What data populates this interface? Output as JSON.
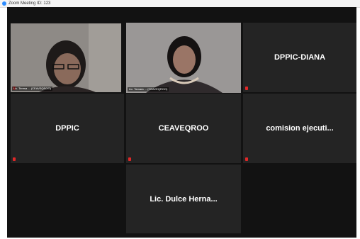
{
  "window": {
    "title": "Zoom Meeting ID: 123"
  },
  "participants": [
    {
      "id": "p1",
      "type": "video",
      "label": "Lic. Teresa ... (CEAVEQROO)",
      "muted": true
    },
    {
      "id": "p2",
      "type": "video",
      "label": "Lic. Tamara ... (CEAVEQROO)",
      "muted": true,
      "active_speaker": true
    },
    {
      "id": "p3",
      "type": "name",
      "name": "DPPIC-DIANA",
      "muted": true
    },
    {
      "id": "p4",
      "type": "name",
      "name": "DPPIC",
      "muted": true
    },
    {
      "id": "p5",
      "type": "name",
      "name": "CEAVEQROO",
      "muted": true
    },
    {
      "id": "p6",
      "type": "name",
      "name": "comision  ejecuti...",
      "muted": true
    },
    {
      "id": "p7",
      "type": "name",
      "name": "Lic. Dulce  Herna...",
      "muted": false
    }
  ],
  "colors": {
    "stage_bg": "#121212",
    "tile_bg": "#242424",
    "active_speaker_border": "#b8e04b",
    "muted_icon": "#e02828"
  },
  "icons": {
    "app": "zoom-icon",
    "muted": "mic-muted-icon"
  }
}
